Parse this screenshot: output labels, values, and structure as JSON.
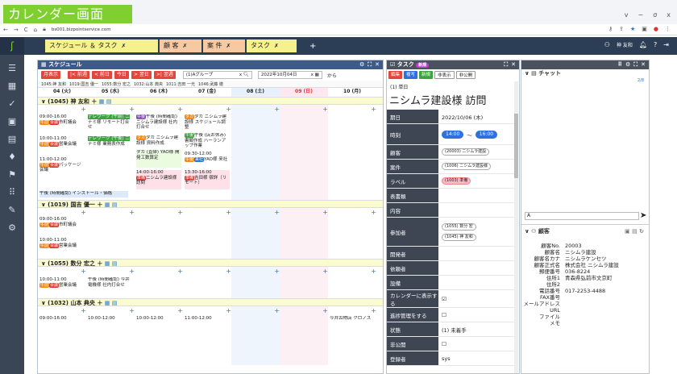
{
  "app": {
    "title": "カレンダー画面",
    "url": "bs001.bizpointservice.com",
    "window_controls": [
      "v",
      "−",
      "σ",
      "x"
    ]
  },
  "header": {
    "tabs": [
      {
        "label": "スケジュール ＆ タスク",
        "x": "✗",
        "color": "#f5f18c"
      },
      {
        "label": "顧 客",
        "x": "✗",
        "color": "#f6c9a2"
      },
      {
        "label": "案 件",
        "x": "✗",
        "color": "#f6c9a2"
      },
      {
        "label": "タスク",
        "x": "✗",
        "color": "#f5f18c"
      }
    ],
    "plus": "+",
    "user": "神 友和"
  },
  "sched": {
    "title": "スケジュール",
    "btn_month": "月表示",
    "btn_prevweek": "|< 前週",
    "btn_prevday": "< 前日",
    "btn_today": "今日",
    "btn_nextday": "> 翌日",
    "btn_nextweek": ">| 翌週",
    "group": "(1)Aグループ",
    "date": "2022年10月04日",
    "from": "から",
    "filters": [
      "1045:神 友和",
      "1019:国吉 優一",
      "1055:数分 宏之",
      "1032:山本 典央",
      "1011:吉田 一光",
      "1046:武藤 徹"
    ],
    "days": [
      {
        "label": "04 (火)",
        "bg": "#fff"
      },
      {
        "label": "05 (水)",
        "bg": "#fff"
      },
      {
        "label": "06 (木)",
        "bg": "#fff"
      },
      {
        "label": "07 (金)",
        "bg": "#fff"
      },
      {
        "label": "08 (土)",
        "bg": "#e6f1fd"
      },
      {
        "label": "09 (日)",
        "bg": "#fde8ef"
      },
      {
        "label": "10 (月)",
        "bg": "#fff"
      }
    ],
    "persons": [
      {
        "label": "∨ (1045) 神 友和 ＋"
      },
      {
        "label": "∨ (1019) 国吉 優一 ＋"
      },
      {
        "label": "∨ (1055) 数分 宏之 ＋"
      },
      {
        "label": "∨ (1032) 山本 典央 ＋"
      }
    ],
    "events": {
      "e1t": "09:00-16:00",
      "e1": "市町議会",
      "e2t": "10:00-11:00",
      "e2": "営業会議",
      "e3t": "11:00-12:00",
      "e3": "パッケージ会議",
      "e4": "テレワーク (午前) ニ",
      "e4b": "ナミ様 リモート打合せ",
      "e5": "テレワーク (午後) ニ",
      "e5b": "ナミ様 業務表作成",
      "e6": "午後 (時間確認) ニシムラ建設様 社内打合せ",
      "e7": "タカ ニシムラ建設様 資料作成",
      "e8": "タカ (直帰) YAO様 開発工数算定",
      "e9": "14:00-16:00",
      "e9b": "ニシムラ建設様 訪問",
      "e10": "タカ ニシムラ建設様 スケジュール調整",
      "e11": "午後 (店お休み) 書類作成 ハーランアップ作業",
      "e12": "09:30-12:00",
      "e12b": "YAO様 来社",
      "e13": "13:30-16:00",
      "e13b": "吉田様 宿詳（リモート）",
      "e14": "午後 (時間確認) インストール・価格",
      "p2e1t": "09:00-16:00",
      "p2e1": "市町議会",
      "p2e2t": "10:00-11:00",
      "p2e2": "営業会議",
      "p3e1t": "10:00-11:00",
      "p3e1": "営業会議",
      "p3e2": "午後 (時間確認) 今井電機様 社内打合せ",
      "p4e1t": "09:00-16:00",
      "p4e2t": "10:00-12:00",
      "p4e3t": "10:00-12:00",
      "p4e4t": "11:00-12:00",
      "p4e5": "今井古物店 クロノス"
    }
  },
  "task": {
    "title": "タスク",
    "badge": "新規",
    "btn_edit": "編集",
    "btn_copy": "複写",
    "btn_new": "新規",
    "btn_hide": "非表示",
    "btn_public": "非公開",
    "day": "(1) 単日",
    "heading": "ニシムラ建設様 訪問",
    "rows": [
      {
        "label": "期日",
        "value": "2022/10/06 (木)"
      },
      {
        "label": "時刻",
        "from": "14:00",
        "tilde": "〜",
        "to": "16:00"
      },
      {
        "label": "顧客",
        "value": "(20003) ニシムラ建設"
      },
      {
        "label": "案件",
        "value": "(1006) ニシムラ建設様"
      },
      {
        "label": "ラベル",
        "value": "(1003) 準備"
      },
      {
        "label": "表書類",
        "value": ""
      },
      {
        "label": "内容",
        "value": ""
      },
      {
        "label": "参加者",
        "value": "(1055) 数分 宏",
        "value2": "(1045) 神 友和"
      },
      {
        "label": "開発者",
        "value": ""
      },
      {
        "label": "依頼者",
        "value": ""
      },
      {
        "label": "設備",
        "value": ""
      },
      {
        "label": "カレンダーに表示する",
        "value": "☑"
      },
      {
        "label": "進捗管理をする",
        "value": "☐"
      },
      {
        "label": "状態",
        "value": "(1) 未着手"
      },
      {
        "label": "非公開",
        "value": "☐"
      },
      {
        "label": "登録者",
        "value": "sys"
      }
    ]
  },
  "right": {
    "chat_title": "チャット",
    "chat_count": "2/8",
    "chat_send": "➤",
    "cust_title": "顧客",
    "cust": [
      {
        "k": "顧客No.",
        "v": "20003"
      },
      {
        "k": "顧客名",
        "v": "ニシムラ建設"
      },
      {
        "k": "顧客名カナ",
        "v": "ニシムラケンセツ"
      },
      {
        "k": "顧客正式名",
        "v": "株式会社 ニシムラ建設"
      },
      {
        "k": "郵便番号",
        "v": "036-8224"
      },
      {
        "k": "住所1",
        "v": "青森県弘前市文京町"
      },
      {
        "k": "住所2",
        "v": ""
      },
      {
        "k": "電話番号",
        "v": "017-2253-4488"
      },
      {
        "k": "FAX番号",
        "v": ""
      },
      {
        "k": "メールアドレス",
        "v": ""
      },
      {
        "k": "URL",
        "v": ""
      },
      {
        "k": "ファイル",
        "v": ""
      },
      {
        "k": "メモ",
        "v": ""
      }
    ]
  }
}
